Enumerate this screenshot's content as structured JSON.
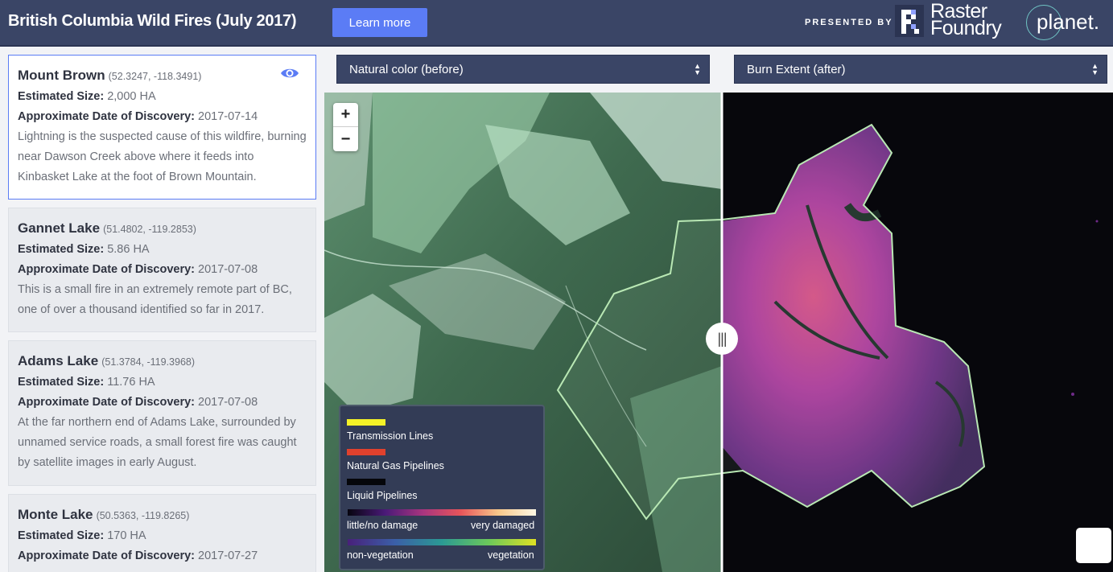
{
  "header": {
    "title": "British Columbia Wild Fires (July 2017)",
    "learn_more": "Learn more",
    "presented_by": "PRESENTED BY",
    "raster_foundry_line1": "Raster",
    "raster_foundry_line2": "Foundry",
    "planet": "planet."
  },
  "labels": {
    "size": "Estimated Size:",
    "date": "Approximate Date of Discovery:"
  },
  "fires": [
    {
      "name": "Mount Brown",
      "coords": "(52.3247, -118.3491)",
      "size": "2,000 HA",
      "date": "2017-07-14",
      "desc": "Lightning is the suspected cause of this wildfire, burning near Dawson Creek above where it feeds into Kinbasket Lake at the foot of Brown Mountain."
    },
    {
      "name": "Gannet Lake",
      "coords": "(51.4802, -119.2853)",
      "size": "5.86 HA",
      "date": "2017-07-08",
      "desc": "This is a small fire in an extremely remote part of BC, one of over a thousand identified so far in 2017."
    },
    {
      "name": "Adams Lake",
      "coords": "(51.3784, -119.3968)",
      "size": "11.76 HA",
      "date": "2017-07-08",
      "desc": "At the far northern end of Adams Lake, surrounded by unnamed service roads, a small forest fire was caught by satellite images in early August."
    },
    {
      "name": "Monte Lake",
      "coords": "(50.5363, -119.8265)",
      "size": "170 HA",
      "date": "2017-07-27",
      "desc": ""
    }
  ],
  "selects": {
    "left": "Natural color (before)",
    "right": "Burn Extent (after)"
  },
  "map": {
    "zoom_in": "+",
    "zoom_out": "−",
    "handle": "|||"
  },
  "legend": {
    "transmission": "Transmission Lines",
    "gas": "Natural Gas Pipelines",
    "liquid": "Liquid Pipelines",
    "damage_low": "little/no damage",
    "damage_high": "very damaged",
    "veg_low": "non-vegetation",
    "veg_high": "vegetation",
    "colors": {
      "transmission": "#f5f227",
      "gas": "#e0412d",
      "liquid": "#05060a",
      "accent": "#5b7cf5",
      "header": "#3a4566",
      "perimeter": "#b9e8b4"
    }
  }
}
